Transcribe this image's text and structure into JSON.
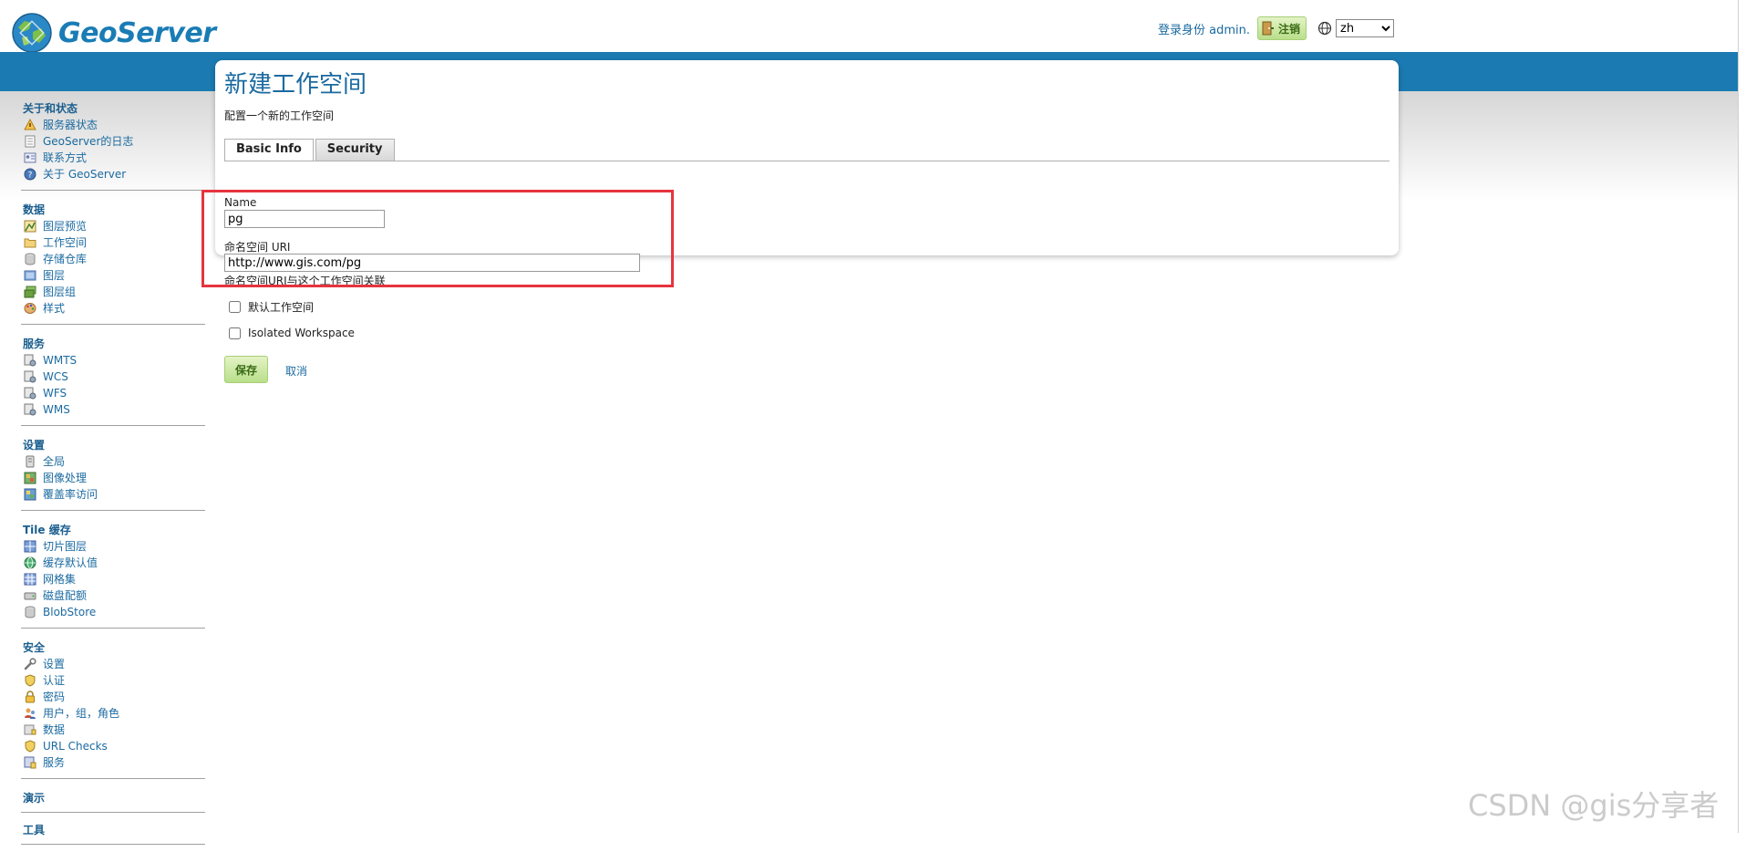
{
  "header": {
    "logo_text": "GeoServer",
    "login_text": "登录身份 admin.",
    "logout_label": "注销",
    "language": "zh",
    "language_options": [
      "zh"
    ]
  },
  "sidebar": {
    "sections": [
      {
        "title": "关于和状态",
        "items": [
          {
            "label": "服务器状态",
            "icon": "server-status-icon"
          },
          {
            "label": "GeoServer的日志",
            "icon": "log-document-icon"
          },
          {
            "label": "联系方式",
            "icon": "contact-card-icon"
          },
          {
            "label": "关于 GeoServer",
            "icon": "about-icon"
          }
        ]
      },
      {
        "title": "数据",
        "items": [
          {
            "label": "图层预览",
            "icon": "layer-preview-icon"
          },
          {
            "label": "工作空间",
            "icon": "folder-icon"
          },
          {
            "label": "存储仓库",
            "icon": "store-icon"
          },
          {
            "label": "图层",
            "icon": "layer-icon"
          },
          {
            "label": "图层组",
            "icon": "layer-group-icon"
          },
          {
            "label": "样式",
            "icon": "palette-icon"
          }
        ]
      },
      {
        "title": "服务",
        "items": [
          {
            "label": "WMTS",
            "icon": "service-icon"
          },
          {
            "label": "WCS",
            "icon": "service-icon"
          },
          {
            "label": "WFS",
            "icon": "service-icon"
          },
          {
            "label": "WMS",
            "icon": "service-icon"
          }
        ]
      },
      {
        "title": "设置",
        "items": [
          {
            "label": "全局",
            "icon": "global-settings-icon"
          },
          {
            "label": "图像处理",
            "icon": "image-processing-icon"
          },
          {
            "label": "覆盖率访问",
            "icon": "coverage-access-icon"
          }
        ]
      },
      {
        "title": "Tile 缓存",
        "items": [
          {
            "label": "切片图层",
            "icon": "tile-layers-icon"
          },
          {
            "label": "缓存默认值",
            "icon": "globe-icon"
          },
          {
            "label": "网格集",
            "icon": "gridset-icon"
          },
          {
            "label": "磁盘配额",
            "icon": "disk-icon"
          },
          {
            "label": "BlobStore",
            "icon": "blobstore-icon"
          }
        ]
      },
      {
        "title": "安全",
        "items": [
          {
            "label": "设置",
            "icon": "wrench-icon"
          },
          {
            "label": "认证",
            "icon": "shield-icon"
          },
          {
            "label": "密码",
            "icon": "lock-icon"
          },
          {
            "label": "用户，组，角色",
            "icon": "users-icon"
          },
          {
            "label": "数据",
            "icon": "data-security-icon"
          },
          {
            "label": "URL Checks",
            "icon": "shield-icon"
          },
          {
            "label": "服务",
            "icon": "services-security-icon"
          }
        ]
      },
      {
        "title": "演示",
        "items": []
      },
      {
        "title": "工具",
        "items": []
      }
    ]
  },
  "main": {
    "title": "新建工作空间",
    "description": "配置一个新的工作空间",
    "tabs": [
      {
        "label": "Basic Info",
        "active": true
      },
      {
        "label": "Security",
        "active": false
      }
    ],
    "form": {
      "name_label": "Name",
      "name_value": "pg",
      "uri_label": "命名空间 URI",
      "uri_value": "http://www.gis.com/pg",
      "uri_help": "命名空间URI与这个工作空间关联",
      "default_workspace_label": "默认工作空间",
      "default_workspace_checked": false,
      "isolated_workspace_label": "Isolated Workspace",
      "isolated_workspace_checked": false
    },
    "save_label": "保存",
    "cancel_label": "取消"
  },
  "watermark": "CSDN @gis分享者",
  "colors": {
    "brand_blue": "#1b7ab1",
    "link_blue": "#1b6aa0",
    "highlight_red": "#e6343f",
    "button_green": "#b9df8a"
  }
}
